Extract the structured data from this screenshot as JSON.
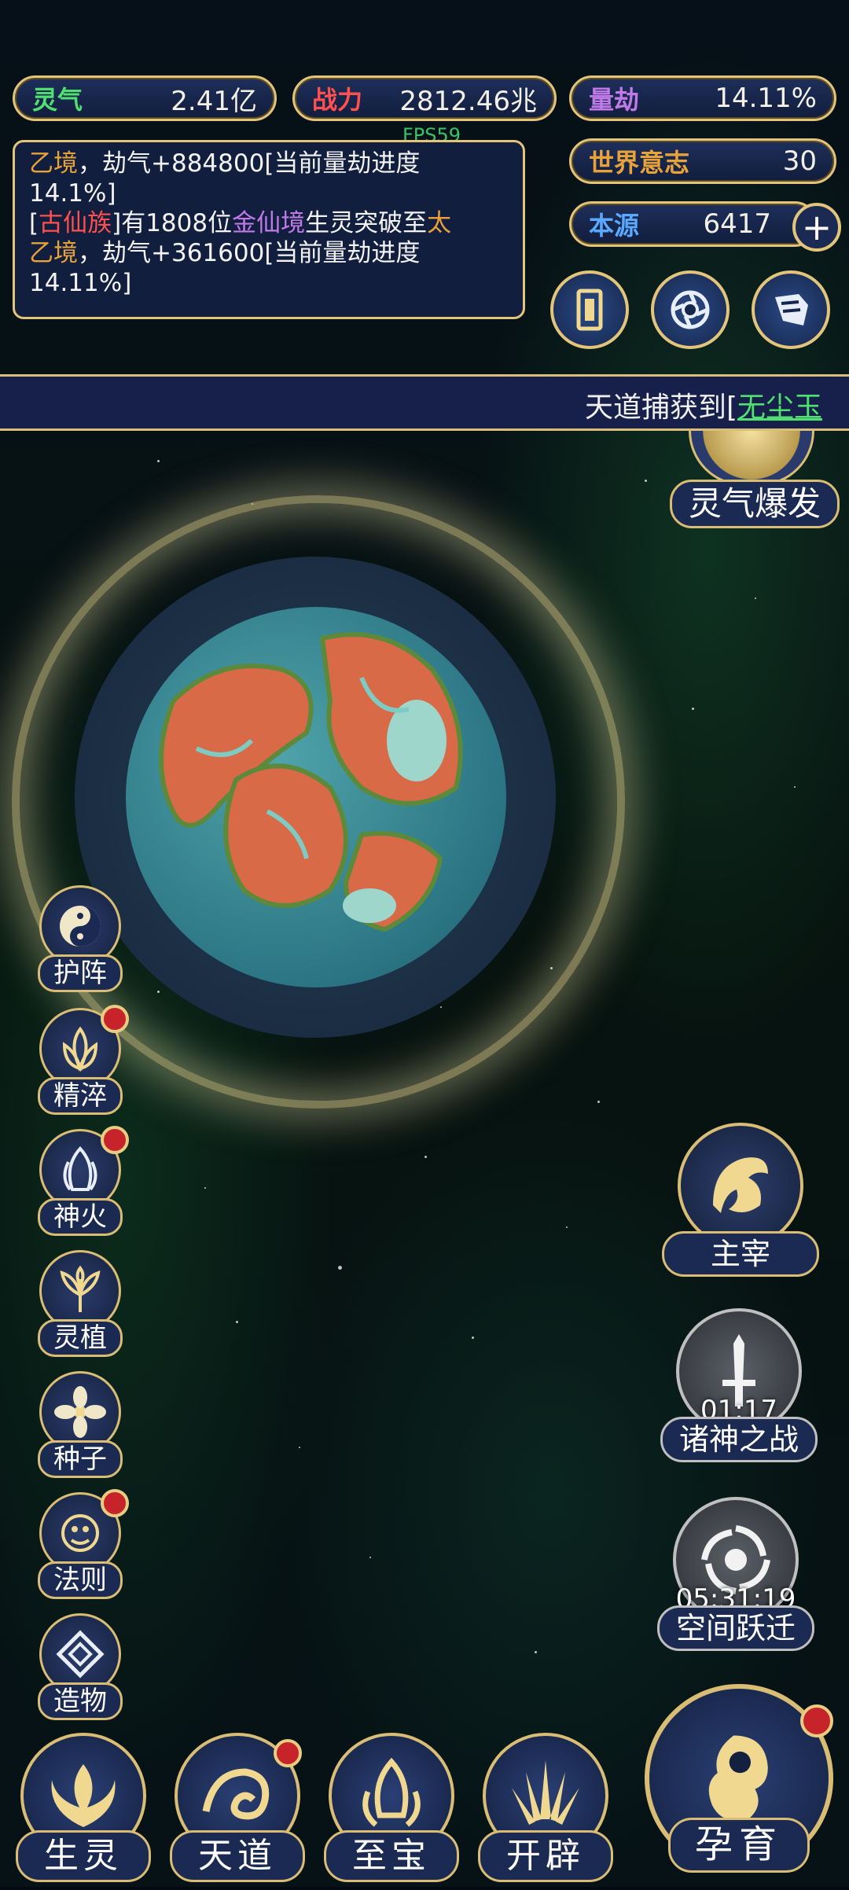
{
  "stats": {
    "lingqi": {
      "label": "灵气",
      "value": "2.41亿"
    },
    "zhanli": {
      "label": "战力",
      "value": "2812.46兆"
    },
    "liangjie": {
      "label": "量劫",
      "value": "14.11%"
    },
    "shijie": {
      "label": "世界意志",
      "value": "30"
    },
    "benyuan": {
      "label": "本源",
      "value": "6417"
    }
  },
  "fps": "FPS59",
  "log": {
    "line1_a": "乙境",
    "line1_b": "，劫气+884800[当前量劫进度",
    "line2": "14.1%]",
    "line3_a": "[",
    "line3_b": "古仙族",
    "line3_c": "]有1808位",
    "line3_d": "金仙境",
    "line3_e": "生灵突破至",
    "line3_f": "太",
    "line4_a": "乙境",
    "line4_b": "，劫气+361600[当前量劫进度",
    "line5": "14.11%]"
  },
  "banner": {
    "prefix": "天道捕获到[",
    "item": "无尘玉"
  },
  "burst": "灵气爆发",
  "left_menu": [
    {
      "label": "护阵",
      "badge": false
    },
    {
      "label": "精淬",
      "badge": true
    },
    {
      "label": "神火",
      "badge": true
    },
    {
      "label": "灵植",
      "badge": false
    },
    {
      "label": "种子",
      "badge": false
    },
    {
      "label": "法则",
      "badge": true
    },
    {
      "label": "造物",
      "badge": false
    }
  ],
  "right_menu": {
    "zhuzai": "主宰",
    "zhushen": {
      "label": "诸神之战",
      "timer": "01:17"
    },
    "kongjian": {
      "label": "空间跃迁",
      "timer": "05:31:19"
    }
  },
  "bottom_menu": {
    "shengling": "生灵",
    "tiandao": "天道",
    "zhibao": "至宝",
    "kaipi": "开辟",
    "yunyu": "孕育"
  },
  "colors": {
    "gold": "#e2c57a",
    "green_link": "#4fe070",
    "red_badge": "#c6232b",
    "purple": "#c07ae8",
    "orange": "#e8a23a"
  }
}
